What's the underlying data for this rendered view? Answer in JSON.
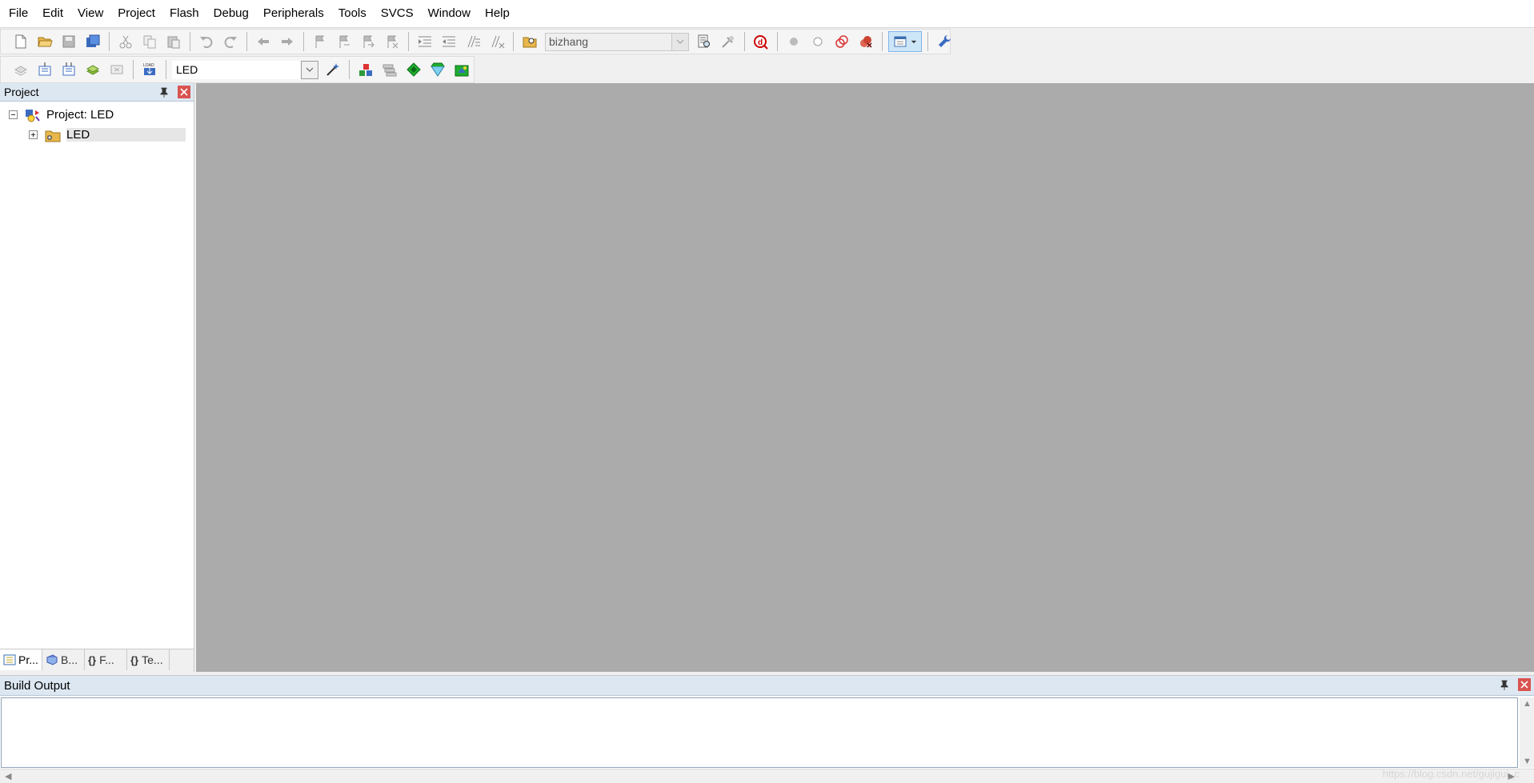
{
  "menu": [
    "File",
    "Edit",
    "View",
    "Project",
    "Flash",
    "Debug",
    "Peripherals",
    "Tools",
    "SVCS",
    "Window",
    "Help"
  ],
  "toolbar": {
    "find_combo_value": "bizhang",
    "target_combo_value": "LED"
  },
  "project_panel": {
    "title": "Project",
    "root_label": "Project: LED",
    "target_label": "LED",
    "tabs": [
      "Pr...",
      "B...",
      "F...",
      "Te..."
    ]
  },
  "build_output": {
    "title": "Build Output"
  },
  "watermark": "https://blog.csdn.net/gujigui_c",
  "colors": {
    "editor_bg": "#ababab",
    "panel_header": "#dde7f1",
    "close_red": "#d9534f"
  }
}
